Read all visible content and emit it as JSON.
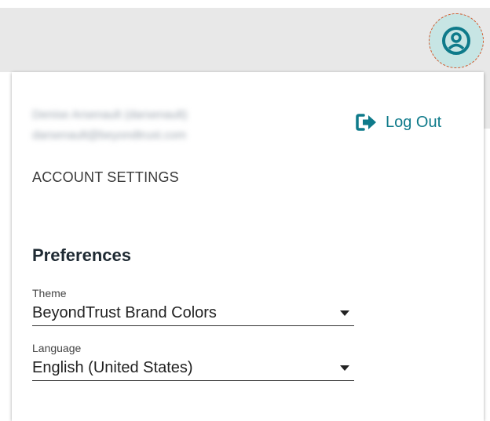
{
  "header": {
    "avatar_icon": "user-circle-icon",
    "accent_color": "#0e7a8a"
  },
  "account": {
    "name_line": "Denise Arsenault (darsenault)",
    "email_line": "darsenault@beyondtrust.com",
    "logout_label": "Log Out",
    "logout_icon": "sign-out-icon",
    "settings_label": "ACCOUNT SETTINGS"
  },
  "preferences": {
    "heading": "Preferences",
    "theme": {
      "label": "Theme",
      "value": "BeyondTrust Brand Colors"
    },
    "language": {
      "label": "Language",
      "value": "English (United States)"
    }
  }
}
